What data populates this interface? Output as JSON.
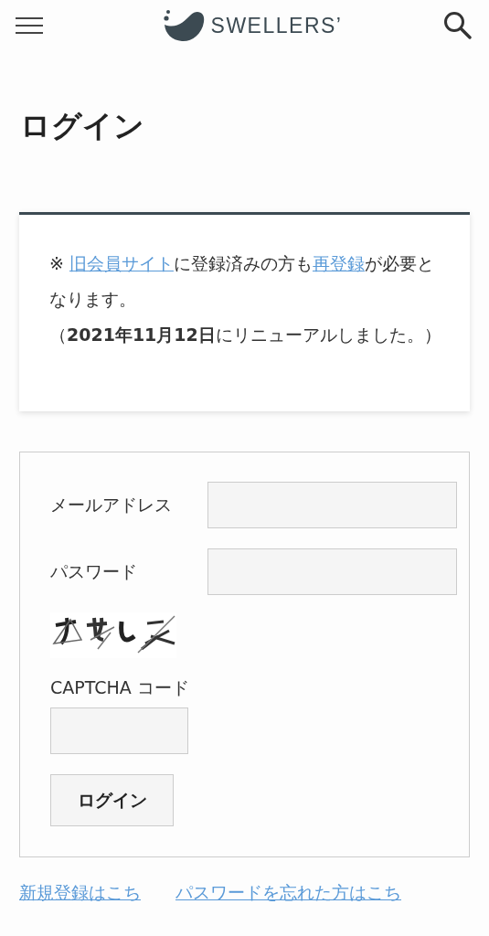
{
  "header": {
    "logo_text": "SWELLERS’"
  },
  "page_title": "ログイン",
  "notice": {
    "line_1": [
      {
        "kind": "text",
        "text": "※ "
      },
      {
        "kind": "link",
        "text": "旧会員サイト"
      },
      {
        "kind": "text",
        "text": "に登録済みの方も"
      },
      {
        "kind": "link",
        "text": "再登録"
      },
      {
        "kind": "text",
        "text": "が必要となります。"
      }
    ],
    "line_2": "（**2021年11月12日**にリニューアルしました。）"
  },
  "form": {
    "fields": [
      {
        "label": "メールアドレス"
      },
      {
        "label": "パスワード"
      }
    ],
    "captcha_label": "CAPTCHA コード",
    "submit": "ログイン"
  },
  "footer_links": [
    "新規登録はこち",
    "パスワードを忘れた方はこち"
  ]
}
